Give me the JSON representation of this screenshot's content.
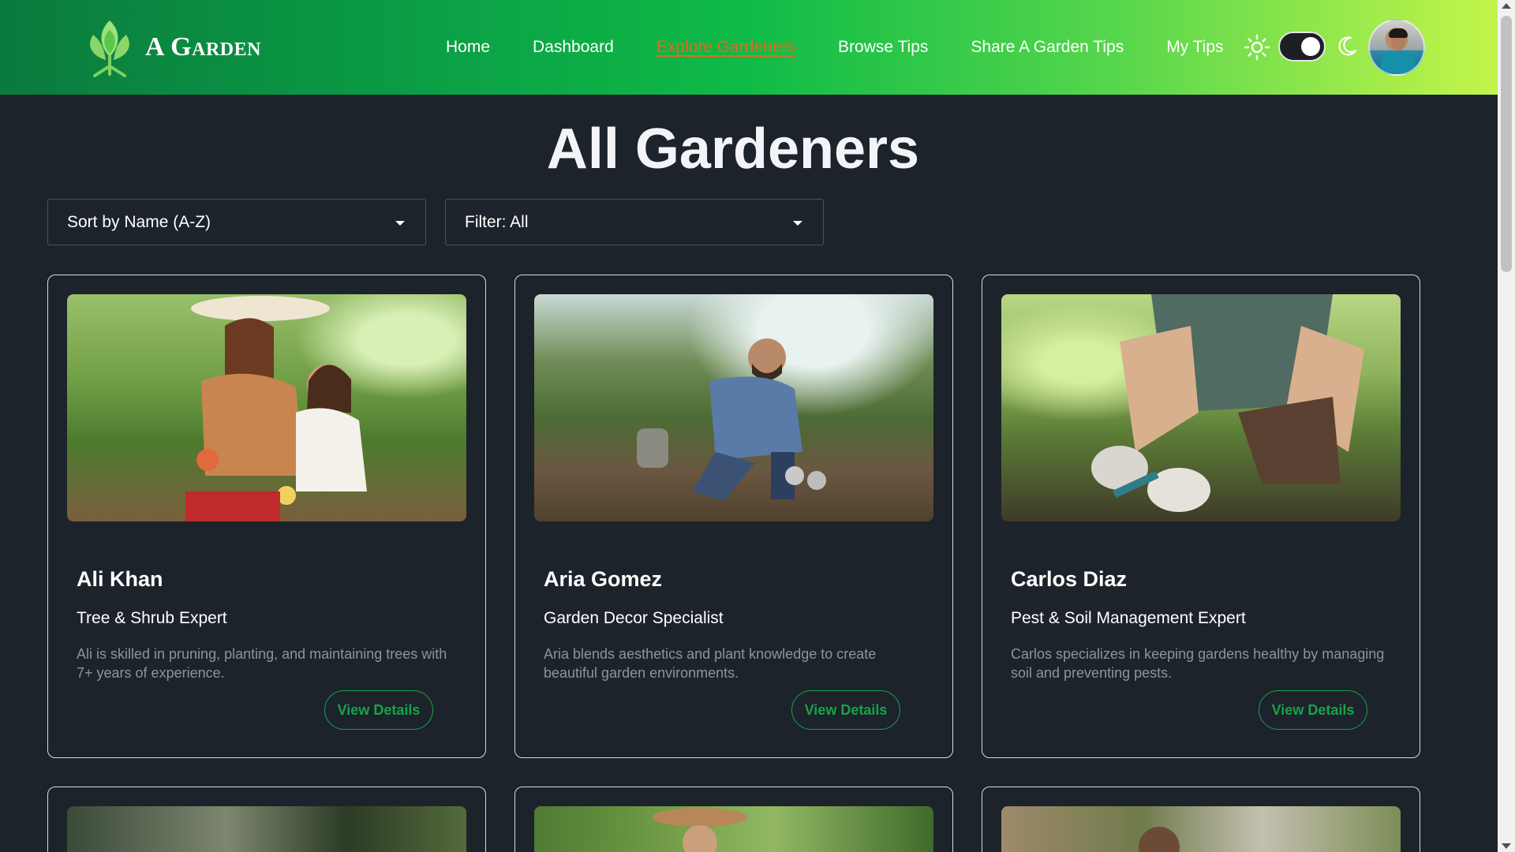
{
  "brand": {
    "name": "A Garden"
  },
  "nav": {
    "links": [
      {
        "label": "Home",
        "active": false
      },
      {
        "label": "Dashboard",
        "active": false
      },
      {
        "label": "Explore Gardeners",
        "active": true
      },
      {
        "label": "Browse Tips",
        "active": false
      },
      {
        "label": "Share A Garden Tips",
        "active": false
      },
      {
        "label": "My Tips",
        "active": false
      }
    ],
    "theme_toggle": {
      "state": "dark"
    }
  },
  "colors": {
    "accent": "#16a34a",
    "active_link": "#e46a1e",
    "background": "#1d232a"
  },
  "page": {
    "title": "All Gardeners"
  },
  "controls": {
    "sort": {
      "selected": "Sort by Name (A-Z)"
    },
    "filter": {
      "selected": "Filter: All"
    }
  },
  "gardeners": [
    {
      "name": "Ali Khan",
      "role": "Tree & Shrub Expert",
      "description": "Ali is skilled in pruning, planting, and maintaining trees with 7+ years of experience.",
      "button": "View Details"
    },
    {
      "name": "Aria Gomez",
      "role": "Garden Decor Specialist",
      "description": "Aria blends aesthetics and plant knowledge to create beautiful garden environments.",
      "button": "View Details"
    },
    {
      "name": "Carlos Diaz",
      "role": "Pest & Soil Management Expert",
      "description": "Carlos specializes in keeping gardens healthy by managing soil and preventing pests.",
      "button": "View Details"
    }
  ]
}
